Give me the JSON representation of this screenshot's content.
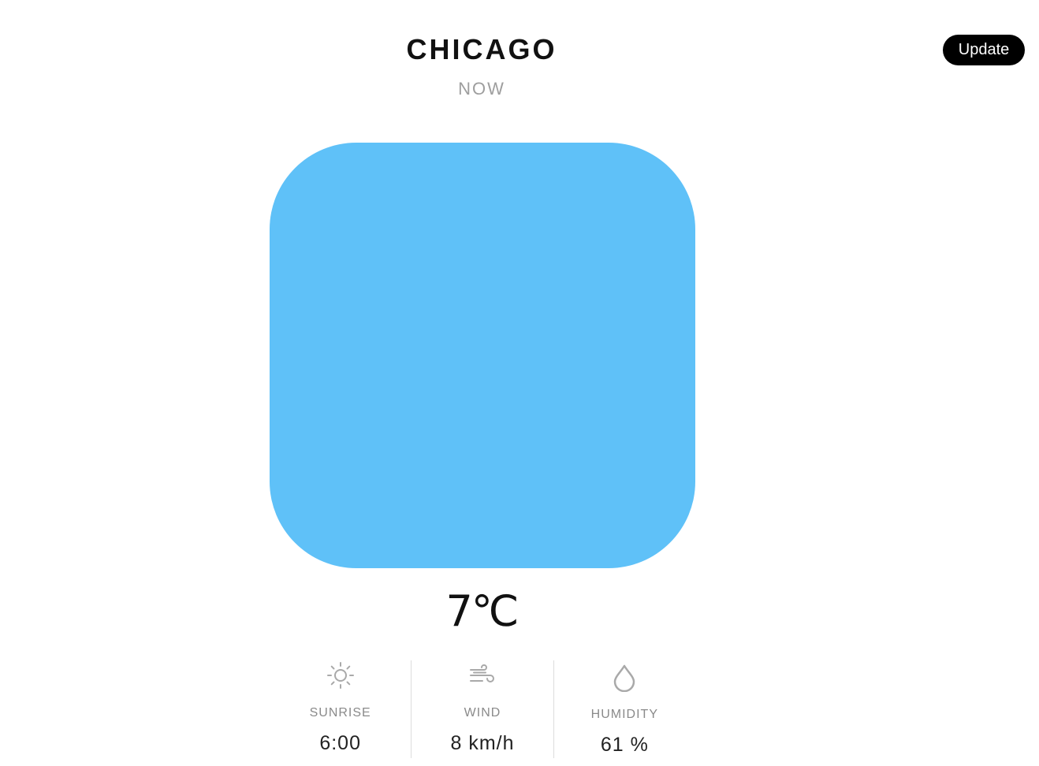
{
  "header": {
    "city": "CHICAGO",
    "time_label": "NOW",
    "update_label": "Update"
  },
  "weather": {
    "tile_color": "#5fc1f8",
    "temperature": "7℃"
  },
  "stats": {
    "sunrise": {
      "icon": "sun-icon",
      "label": "SUNRISE",
      "value": "6:00"
    },
    "wind": {
      "icon": "wind-icon",
      "label": "WIND",
      "value": "8 km/h"
    },
    "humidity": {
      "icon": "droplet-icon",
      "label": "HUMIDITY",
      "value": "61 %"
    }
  }
}
